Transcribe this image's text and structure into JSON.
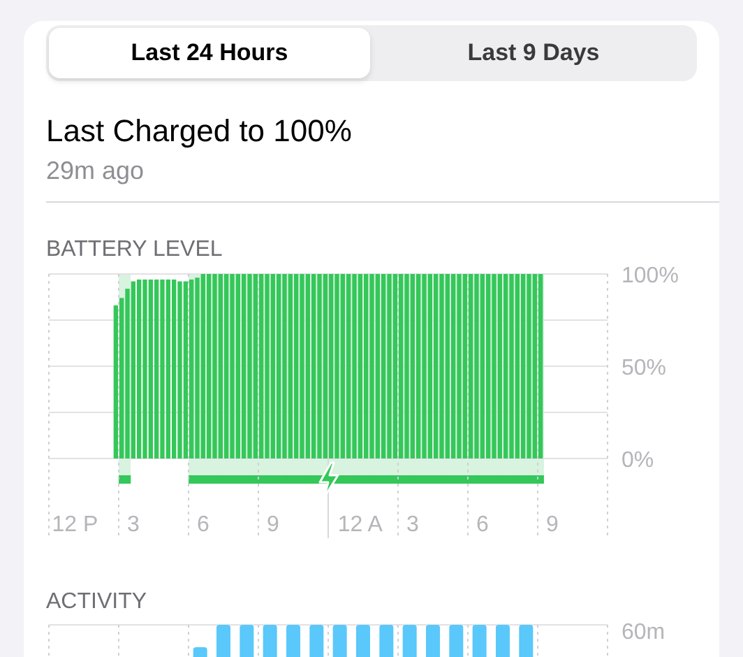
{
  "tabs": [
    {
      "label": "Last 24 Hours",
      "selected": true
    },
    {
      "label": "Last 9 Days",
      "selected": false
    }
  ],
  "last_charged": {
    "title": "Last Charged to 100%",
    "time": "29m ago"
  },
  "battery_level": {
    "heading": "BATTERY LEVEL",
    "chart_data": {
      "type": "bar",
      "ylim": [
        0,
        100
      ],
      "yticks": [
        {
          "value": 100,
          "label": "100%"
        },
        {
          "value": 50,
          "label": "50%"
        },
        {
          "value": 0,
          "label": "0%"
        }
      ],
      "categories": [
        null,
        null,
        null,
        null,
        "12 P",
        null,
        null,
        null,
        null,
        null,
        null,
        null,
        null,
        null,
        "3",
        null,
        null,
        null,
        null,
        null,
        null,
        null,
        null,
        null,
        null,
        null,
        "6",
        null,
        null,
        null,
        null,
        null,
        null,
        null,
        null,
        null,
        null,
        null,
        "9",
        null,
        null,
        null,
        null,
        null,
        null,
        null,
        null,
        null,
        null,
        null,
        null,
        null,
        null,
        "12 A",
        null,
        null,
        null,
        null,
        null,
        null,
        null,
        null,
        "3",
        null,
        null,
        null,
        null,
        null,
        null,
        null,
        null,
        null,
        null,
        null,
        "6",
        null,
        null,
        null,
        null,
        null,
        null,
        null,
        null,
        null,
        null,
        null,
        "9",
        null,
        null,
        null,
        null,
        null,
        null,
        null,
        null,
        null
      ],
      "series": [
        {
          "color": "#34c759",
          "values": [
            null,
            null,
            null,
            null,
            null,
            null,
            null,
            null,
            null,
            null,
            null,
            83,
            87,
            92,
            96,
            97,
            97,
            97,
            97,
            97,
            97,
            97,
            96,
            96,
            97,
            98,
            100,
            100,
            100,
            100,
            100,
            100,
            100,
            100,
            100,
            100,
            100,
            100,
            100,
            100,
            100,
            100,
            100,
            100,
            100,
            100,
            100,
            100,
            100,
            100,
            100,
            100,
            100,
            100,
            100,
            100,
            100,
            100,
            100,
            100,
            100,
            100,
            100,
            100,
            100,
            100,
            100,
            100,
            100,
            100,
            100,
            100,
            100,
            100,
            100,
            100,
            100,
            100,
            100,
            100,
            100,
            100,
            100,
            100,
            100,
            null,
            null,
            null,
            null,
            null,
            null,
            null,
            null,
            null,
            null,
            null
          ]
        }
      ]
    },
    "charging": [
      false,
      false,
      false,
      false,
      false,
      false,
      false,
      false,
      false,
      false,
      false,
      false,
      true,
      true,
      false,
      false,
      false,
      false,
      false,
      false,
      false,
      false,
      false,
      false,
      true,
      true,
      true,
      true,
      true,
      true,
      true,
      true,
      true,
      true,
      true,
      true,
      true,
      true,
      true,
      true,
      true,
      true,
      true,
      true,
      true,
      true,
      true,
      true,
      true,
      true,
      true,
      true,
      true,
      true,
      true,
      true,
      true,
      true,
      true,
      true,
      true,
      true,
      true,
      true,
      true,
      true,
      true,
      true,
      true,
      true,
      true,
      true,
      true,
      true,
      true,
      true,
      true,
      true,
      true,
      true,
      true,
      true,
      true,
      true,
      true,
      false,
      false,
      false,
      false,
      false,
      false,
      false,
      false,
      false,
      false,
      false
    ]
  },
  "activity": {
    "heading": "ACTIVITY",
    "axis_label": "60m"
  }
}
